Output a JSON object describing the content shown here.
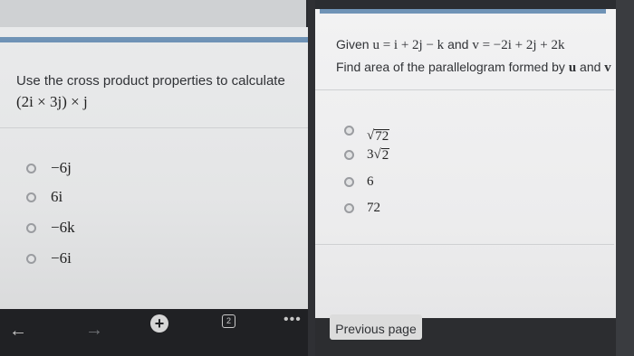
{
  "left": {
    "question": "Use the cross product properties to calculate",
    "expression": "(2i × 3j) × j",
    "options": [
      "−6j",
      "6i",
      "−6k",
      "−6i"
    ]
  },
  "toolbar": {
    "back": "←",
    "forward": "→",
    "add": "+",
    "tabs_count": "2",
    "more": "•••"
  },
  "right": {
    "given_prefix": "Given",
    "given_u": "u = i + 2j − k",
    "given_and": "and",
    "given_v": "v = −2i + 2j + 2k",
    "find_text": "Find area of the parallelogram formed by",
    "find_u": "u",
    "find_and": "and",
    "find_v": "v",
    "options": [
      {
        "root": "",
        "radicand": "72"
      },
      {
        "root": "3",
        "radicand": "2"
      },
      {
        "root": "6",
        "radicand": ""
      },
      {
        "root": "72",
        "radicand": ""
      }
    ],
    "previous_page": "Previous page"
  }
}
